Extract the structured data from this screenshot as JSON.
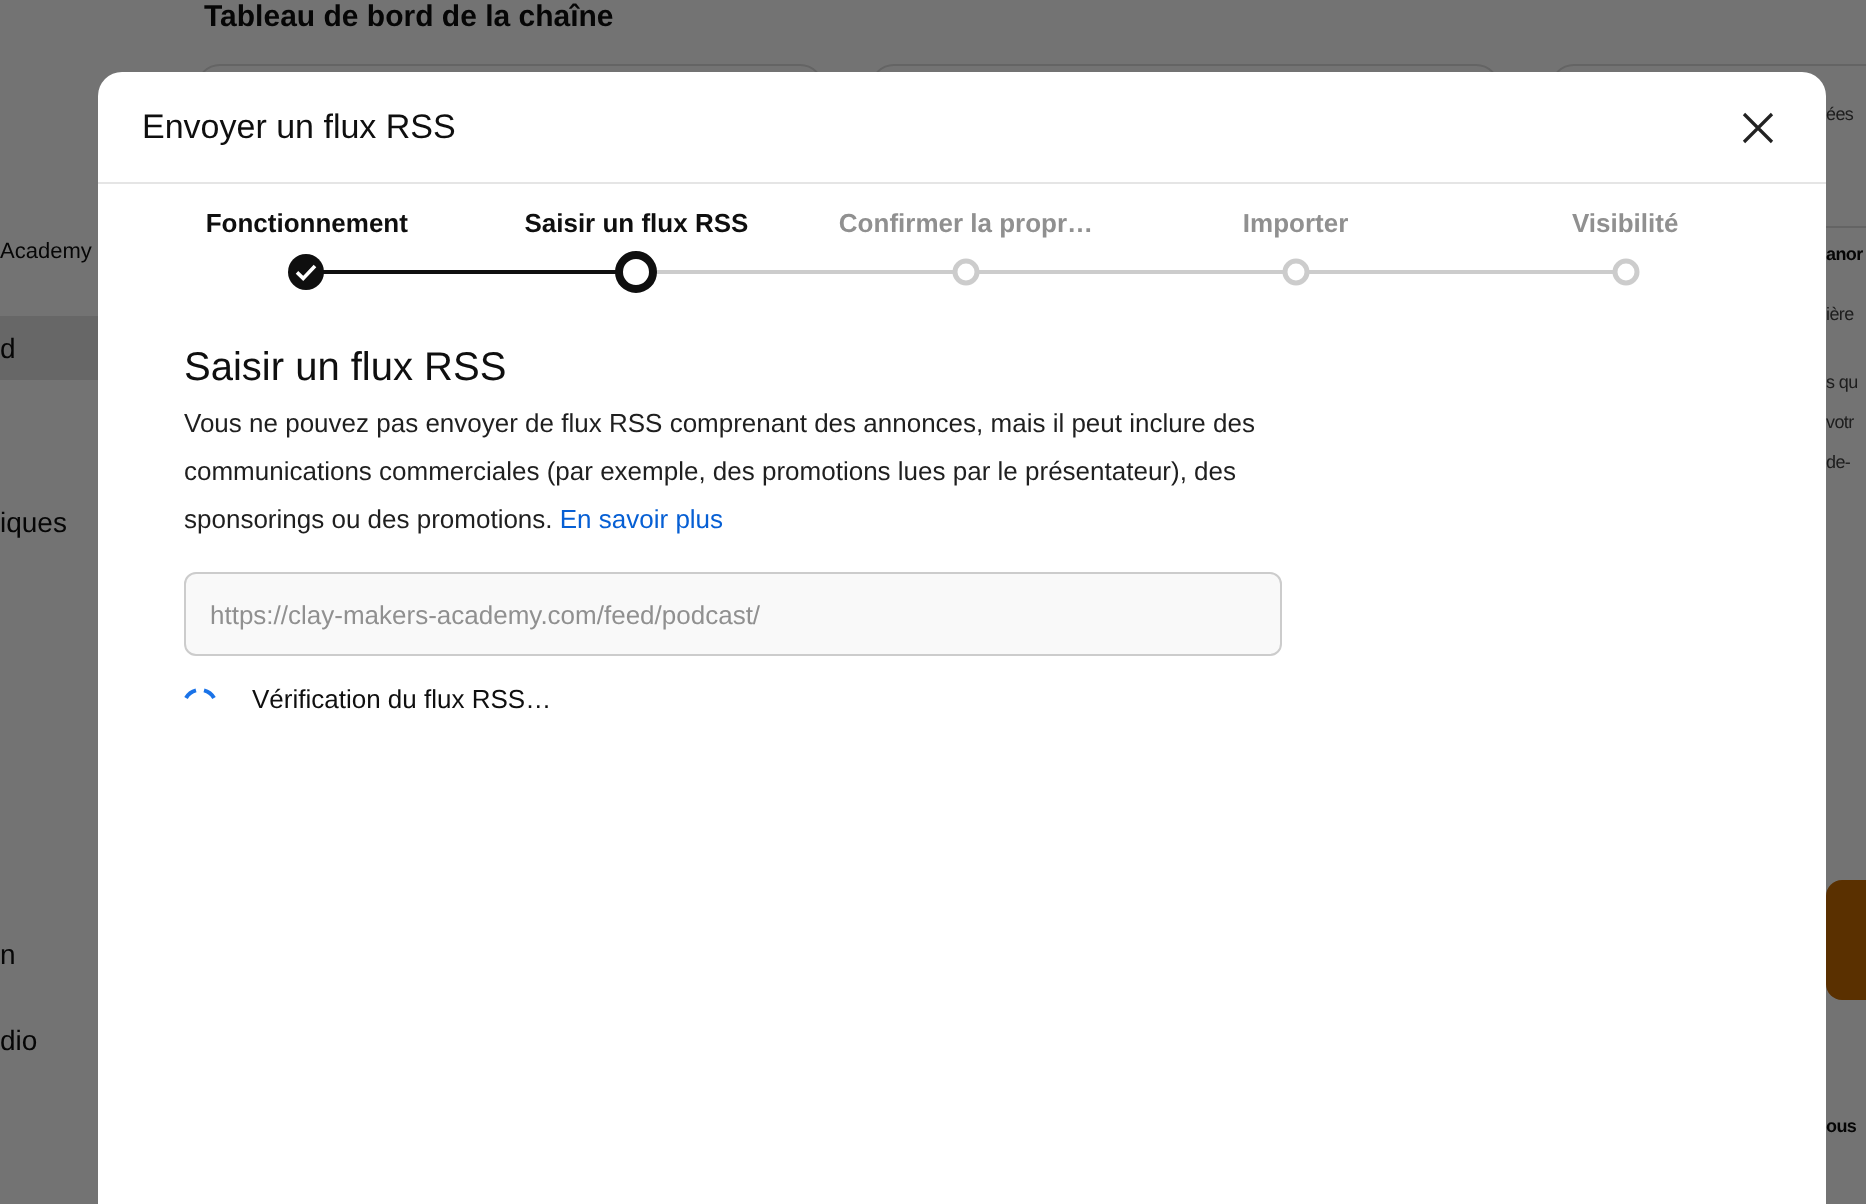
{
  "background": {
    "page_title": "Tableau de bord de la chaîne",
    "sidebar": [
      {
        "label": "Academy",
        "selected": false
      },
      {
        "label": "d",
        "selected": true
      },
      {
        "label": "iques",
        "selected": false
      },
      {
        "label": "n",
        "selected": false
      },
      {
        "label": "dio",
        "selected": false
      }
    ],
    "right_column": [
      "ées",
      "anor",
      "ière",
      "s qu",
      "votr",
      "de-",
      "ous"
    ]
  },
  "dialog": {
    "title": "Envoyer un flux RSS",
    "steps": [
      {
        "label": "Fonctionnement",
        "completed": true,
        "selected": false
      },
      {
        "label": "Saisir un flux RSS",
        "completed": false,
        "selected": true
      },
      {
        "label": "Confirmer la propr…",
        "completed": false,
        "selected": false
      },
      {
        "label": "Importer",
        "completed": false,
        "selected": false
      },
      {
        "label": "Visibilité",
        "completed": false,
        "selected": false
      }
    ],
    "heading": "Saisir un flux RSS",
    "description": "Vous ne pouvez pas envoyer de flux RSS comprenant des annonces, mais il peut inclure des communications commerciales (par exemple, des promotions lues par le présentateur), des sponsorings ou des promotions.",
    "learn_more": "En savoir plus",
    "feed_url": {
      "value": "https://clay-makers-academy.com/feed/podcast/",
      "disabled": true
    },
    "status": "Vérification du flux RSS…"
  }
}
